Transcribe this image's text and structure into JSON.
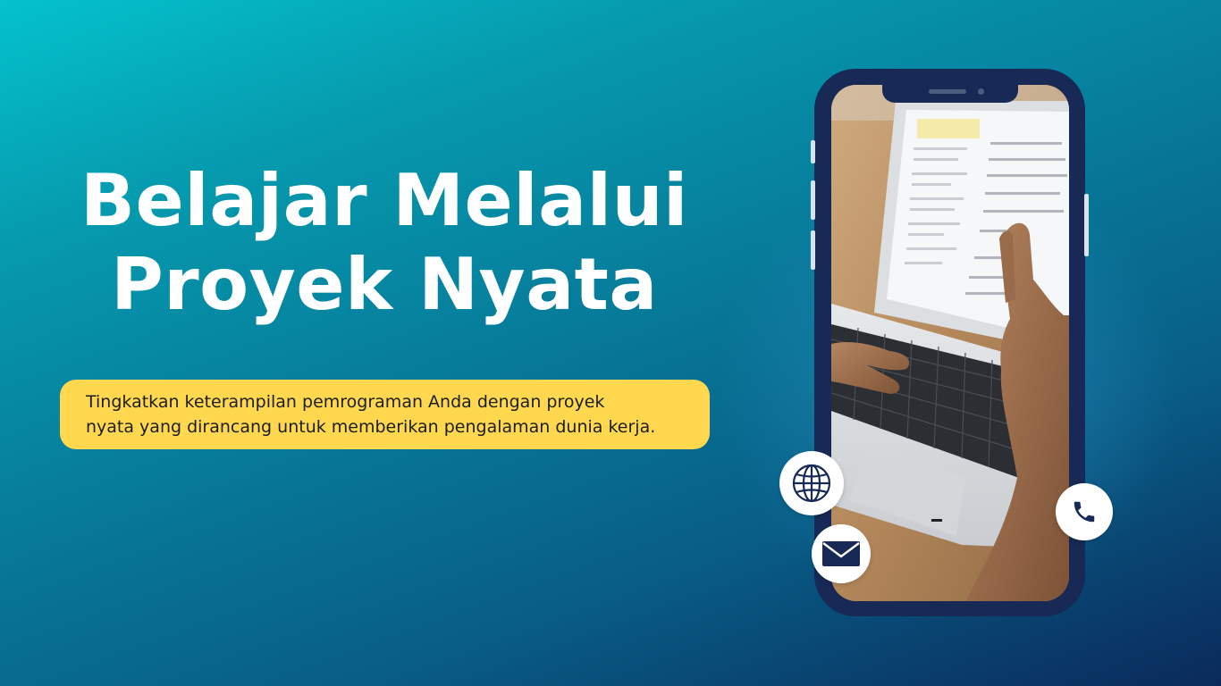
{
  "headline": {
    "line1": "Belajar Melalui",
    "line2": "Proyek Nyata"
  },
  "subtitle": {
    "line1": "Tingkatkan keterampilan pemrograman Anda dengan proyek",
    "line2": "nyata yang dirancang untuk memberikan pengalaman dunia kerja."
  },
  "icons": {
    "globe": "globe-icon",
    "email": "envelope-icon",
    "phone": "phone-icon"
  },
  "colors": {
    "background_top": "#04c2cc",
    "background_bottom": "#0a2a5b",
    "pill": "#ffd84f",
    "phone_frame": "#172954",
    "headline_text": "#ffffff"
  }
}
